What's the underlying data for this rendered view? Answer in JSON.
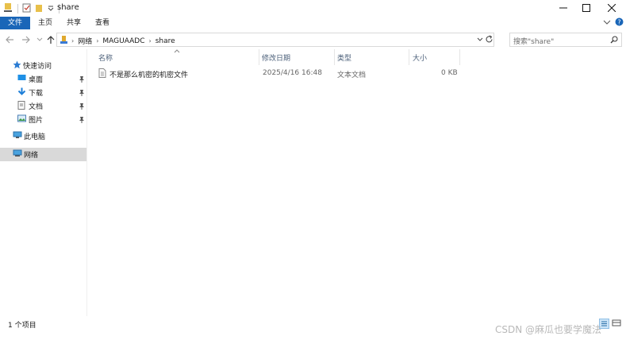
{
  "window": {
    "title": "share"
  },
  "ribbon": {
    "tabs": [
      "文件",
      "主页",
      "共享",
      "查看"
    ]
  },
  "address": {
    "crumbs": [
      "网络",
      "MAGUAADC",
      "share"
    ]
  },
  "search": {
    "placeholder": "搜索\"share\""
  },
  "sidebar": {
    "items": [
      {
        "label": "快速访问",
        "icon": "star-icon"
      },
      {
        "label": "桌面",
        "icon": "desktop-icon",
        "pinned": true
      },
      {
        "label": "下载",
        "icon": "download-icon",
        "pinned": true
      },
      {
        "label": "文档",
        "icon": "documents-icon",
        "pinned": true
      },
      {
        "label": "图片",
        "icon": "pictures-icon",
        "pinned": true
      },
      {
        "label": "此电脑",
        "icon": "computer-icon"
      },
      {
        "label": "网络",
        "icon": "network-icon",
        "selected": true
      }
    ]
  },
  "columns": [
    "名称",
    "修改日期",
    "类型",
    "大小"
  ],
  "files": [
    {
      "name": "不是那么机密的机密文件",
      "modified": "2025/4/16 16:48",
      "type": "文本文档",
      "size": "0 KB"
    }
  ],
  "status": {
    "count": "1 个项目"
  },
  "watermark": "CSDN @麻瓜也要学魔法",
  "colors": {
    "accent": "#1a66b8",
    "selected_bg": "#d9d9d9",
    "header_text": "#4c607a"
  }
}
